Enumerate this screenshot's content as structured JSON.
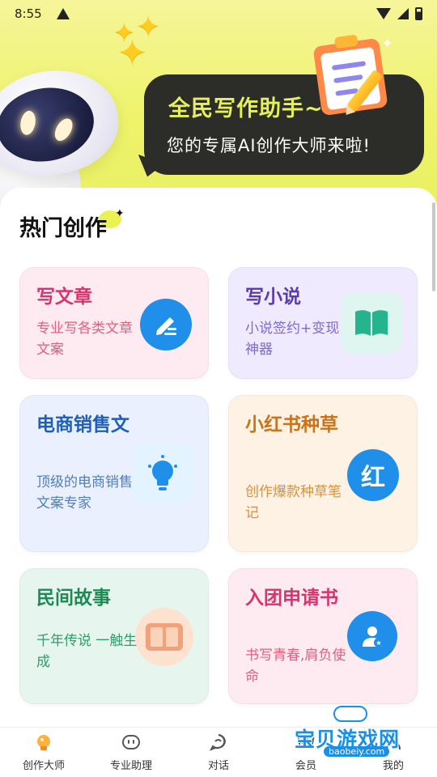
{
  "status_bar": {
    "time": "8:55",
    "warning_icon": "warning-icon",
    "wifi_icon": "wifi-icon",
    "signal_icon": "cell-signal-icon",
    "battery_icon": "battery-icon"
  },
  "hero": {
    "title": "全民写作助手~",
    "subtitle": "您的专属AI创作大师来啦!",
    "accent_color": "#e6f05a",
    "background_color": "#eef36a"
  },
  "main": {
    "section_title": "热门创作",
    "cards": [
      {
        "title": "写文章",
        "desc": "专业写各类文章文案",
        "icon": "pencil-edit-icon",
        "title_color": "#d7336d",
        "desc_color": "#e2607f",
        "bg": "#fdebf1",
        "icon_bg": "#1f8fea",
        "icon_glyph": "✎"
      },
      {
        "title": "写小说",
        "desc": "小说签约+变现 神器",
        "icon": "open-book-icon",
        "title_color": "#5b3bb3",
        "desc_color": "#7b6bcc",
        "bg": "#efeafd",
        "icon_bg": "#dff5f0",
        "icon_glyph": ""
      },
      {
        "title": "电商销售文",
        "desc": "顶级的电商销售文案专家",
        "icon": "lightbulb-icon",
        "title_color": "#1f5fb8",
        "desc_color": "#4f7fbf",
        "bg": "#eaf0fd",
        "icon_bg": "#e3f3ff",
        "icon_glyph": ""
      },
      {
        "title": "小红书种草",
        "desc": "创作爆款种草笔记",
        "icon": "xiaohongshu-icon",
        "title_color": "#c9731a",
        "desc_color": "#d9913c",
        "bg": "#fdf2e4",
        "icon_bg": "#1f8fea",
        "icon_glyph": "红"
      },
      {
        "title": "民间故事",
        "desc": "千年传说 一触生成",
        "icon": "story-book-icon",
        "title_color": "#1b8a53",
        "desc_color": "#2f9e6a",
        "bg": "#e6f6ee",
        "icon_bg": "#fde2cf",
        "icon_glyph": ""
      },
      {
        "title": "入团申请书",
        "desc": "书写青春,肩负使命",
        "icon": "user-badge-icon",
        "title_color": "#d7336d",
        "desc_color": "#e2607f",
        "bg": "#fdebf1",
        "icon_bg": "#1f8fea",
        "icon_glyph": ""
      }
    ]
  },
  "bottom_nav": {
    "items": [
      {
        "label": "创作大师",
        "icon": "lightbulb-nav-icon",
        "active": true
      },
      {
        "label": "专业助理",
        "icon": "robot-face-icon",
        "active": false
      },
      {
        "label": "对话",
        "icon": "chat-bubble-icon",
        "active": false
      },
      {
        "label": "会员",
        "icon": "vip-icon",
        "active": false
      },
      {
        "label": "我的",
        "icon": "profile-icon",
        "active": false
      }
    ]
  },
  "watermark": {
    "text": "宝贝游戏网",
    "url": "baobeiy.com"
  }
}
